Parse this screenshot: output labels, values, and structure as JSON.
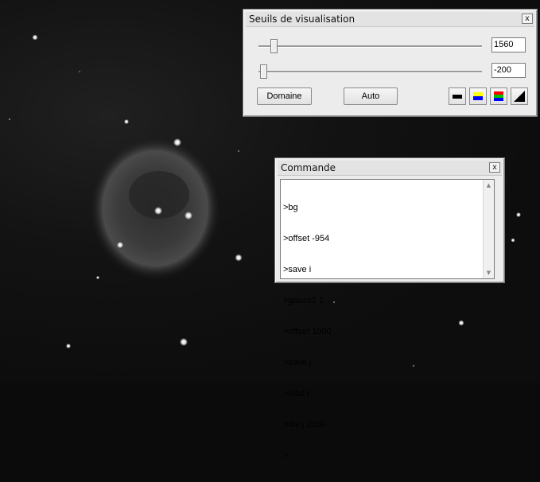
{
  "thresholds_window": {
    "title": "Seuils de visualisation",
    "high_value": "1560",
    "low_value": "-200",
    "domain_button": "Domaine",
    "auto_button": "Auto",
    "palette_buttons": [
      "grayscale-palette-icon",
      "yellow-blue-palette-icon",
      "rainbow-palette-icon",
      "inverse-ramp-icon"
    ]
  },
  "command_window": {
    "title": "Commande",
    "lines": [
      ">bg",
      ">offset -954",
      ">save i",
      ">gauss2 1",
      ">offset 1000",
      ">save j",
      ">load i",
      ">div j 2000",
      ">"
    ]
  },
  "close_glyph": "x",
  "scroll_up_glyph": "▲",
  "scroll_down_glyph": "▼"
}
